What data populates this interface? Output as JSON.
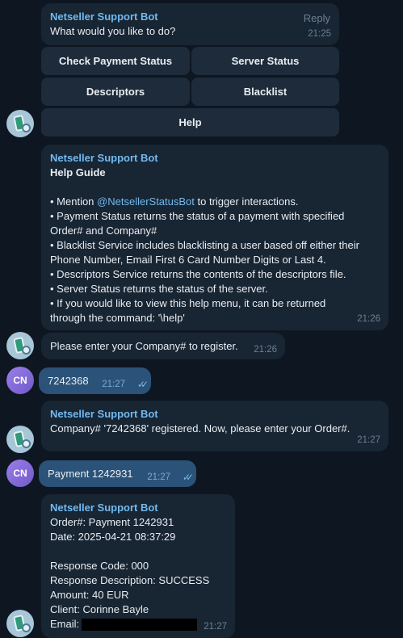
{
  "bot_name": "Netseller Support Bot",
  "user_initials": "CN",
  "menu_message": {
    "reply_label": "Reply",
    "text": "What would you like to do?",
    "time": "21:25",
    "buttons": [
      "Check Payment Status",
      "Server Status",
      "Descriptors",
      "Blacklist",
      "Help"
    ]
  },
  "help_message": {
    "title": "Help Guide",
    "line1_prefix": "• Mention ",
    "mention": "@NetsellerStatusBot",
    "line1_suffix": " to trigger interactions.",
    "lines": [
      "• Payment Status returns the status of a payment with specified Order# and Company#",
      "• Blacklist Service includes blacklisting a user based off either their Phone Number, Email First 6 Card Number Digits or Last 4.",
      "• Descriptors Service returns the contents of the descriptors file.",
      "• Server Status returns the status of the server.",
      "• If you would like to view this help menu, it can be returned through the command: '\\help'"
    ],
    "time": "21:26"
  },
  "company_prompt": {
    "text": "Please enter your Company# to register.",
    "time": "21:26"
  },
  "user_company": {
    "text": "7242368",
    "time": "21:27"
  },
  "company_registered": {
    "text": "Company# '7242368' registered. Now, please enter your Order#.",
    "time": "21:27"
  },
  "user_order": {
    "text": "Payment 1242931",
    "time": "21:27"
  },
  "payment_result": {
    "lines": [
      "Order#: Payment 1242931",
      "Date: 2025-04-21 08:37:29",
      "",
      "Response Code: 000",
      "Response Description: SUCCESS",
      "Amount: 40 EUR",
      "Client: Corinne Bayle"
    ],
    "email_label": "Email:",
    "time": "21:27"
  }
}
